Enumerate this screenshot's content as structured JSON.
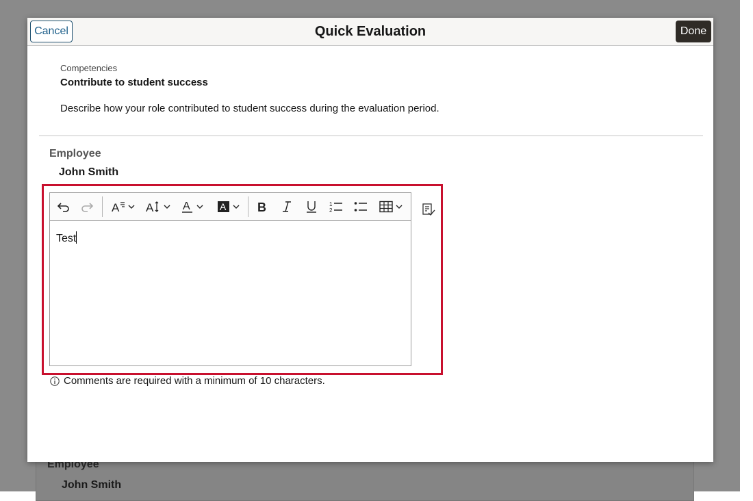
{
  "background": {
    "employee_label": "Employee",
    "employee_name": "John Smith"
  },
  "modal": {
    "title": "Quick Evaluation",
    "cancel_label": "Cancel",
    "done_label": "Done"
  },
  "competency": {
    "section_label": "Competencies",
    "title": "Contribute to student success",
    "description": "Describe how your role contributed to student success during the evaluation period."
  },
  "employee": {
    "label": "Employee",
    "name": "John Smith"
  },
  "editor": {
    "content": "Test",
    "toolbar": [
      "undo-icon",
      "redo-icon",
      "paragraph-format-icon",
      "font-size-icon",
      "text-color-icon",
      "background-color-icon",
      "bold-icon",
      "italic-icon",
      "underline-icon",
      "numbered-list-icon",
      "bulleted-list-icon",
      "table-icon"
    ]
  },
  "hint": {
    "text": "Comments are required with a minimum of 10 characters."
  },
  "colors": {
    "highlight": "#c8102e",
    "done_button": "#2f2b26",
    "cancel_text": "#1d5f8a"
  }
}
